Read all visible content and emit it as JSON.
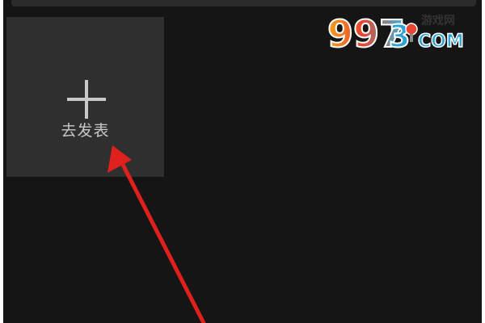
{
  "screen": {
    "publish_tile": {
      "label": "去发表",
      "icon": "plus-icon"
    }
  },
  "watermark": {
    "logo_text": "9973",
    "logo_subtitle": "游戏网",
    "logo_domain": "COM"
  },
  "annotation": {
    "arrow_color": "#e0201c"
  },
  "colors": {
    "background": "#151515",
    "tile": "#2f2f2f",
    "tile_text": "#c8c8c8"
  }
}
